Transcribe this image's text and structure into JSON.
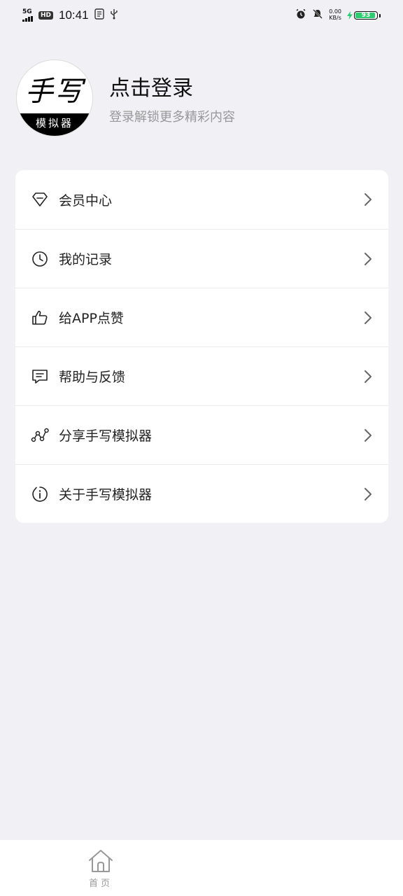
{
  "status_bar": {
    "network": "5G",
    "hd": "HD",
    "time": "10:41",
    "speed_value": "0.00",
    "speed_unit": "KB/s",
    "battery": "93",
    "battery_level": 0.93
  },
  "profile": {
    "avatar_main": "手写",
    "avatar_sub": "模拟器",
    "login_title": "点击登录",
    "login_subtitle": "登录解锁更多精彩内容"
  },
  "menu": {
    "items": [
      {
        "label": "会员中心",
        "icon": "diamond-icon"
      },
      {
        "label": "我的记录",
        "icon": "clock-icon"
      },
      {
        "label": "给APP点赞",
        "icon": "thumbs-up-icon"
      },
      {
        "label": "帮助与反馈",
        "icon": "message-icon"
      },
      {
        "label": "分享手写模拟器",
        "icon": "share-icon"
      },
      {
        "label": "关于手写模拟器",
        "icon": "info-icon"
      }
    ]
  },
  "bottom_nav": {
    "home_label": "首页",
    "home_icon": "home-icon"
  },
  "colors": {
    "background": "#f0f0f5",
    "card": "#ffffff",
    "text_primary": "#222222",
    "text_secondary": "#999999",
    "battery_fill": "#2ecc71"
  }
}
